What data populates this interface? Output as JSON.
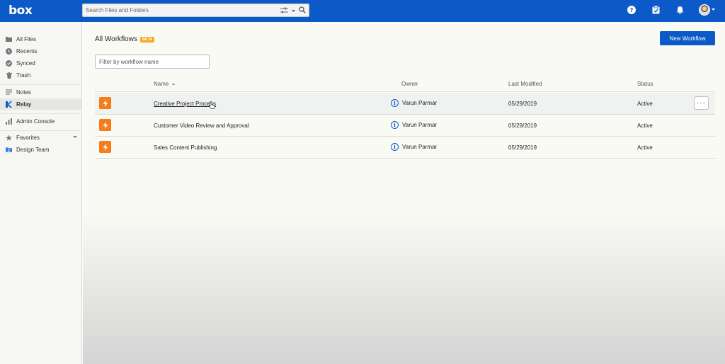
{
  "app": {
    "logo": "box"
  },
  "search": {
    "placeholder": "Search Files and Folders"
  },
  "topbar": {
    "icons": [
      "help-icon",
      "tasks-icon",
      "notifications-icon",
      "avatar"
    ]
  },
  "sidebar": {
    "items": [
      {
        "label": "All Files",
        "icon": "folder-icon"
      },
      {
        "label": "Recents",
        "icon": "clock-icon"
      },
      {
        "label": "Synced",
        "icon": "check-circle-icon"
      },
      {
        "label": "Trash",
        "icon": "trash-icon"
      },
      {
        "label": "Notes",
        "icon": "notes-icon"
      },
      {
        "label": "Relay",
        "icon": "relay-icon",
        "active": true
      },
      {
        "label": "Admin Console",
        "icon": "bar-chart-icon"
      },
      {
        "label": "Favorites",
        "icon": "star-icon"
      },
      {
        "label": "Design Team",
        "icon": "folder-collab-icon"
      }
    ]
  },
  "main": {
    "title": "All Workflows",
    "badge": "BETA",
    "new_button": "New Workflow",
    "filter_placeholder": "Filter by workflow name",
    "columns": {
      "name": "Name",
      "owner": "Owner",
      "modified": "Last Modified",
      "status": "Status"
    },
    "rows": [
      {
        "name": "Creative Project Process",
        "owner": "Varun Parmar",
        "modified": "05/29/2019",
        "status": "Active"
      },
      {
        "name": "Customer Video Review and Approval",
        "owner": "Varun Parmar",
        "modified": "05/29/2019",
        "status": "Active"
      },
      {
        "name": "Sales Content Publishing",
        "owner": "Varun Parmar",
        "modified": "05/29/2019",
        "status": "Active"
      }
    ],
    "more_label": "···"
  },
  "colors": {
    "brand": "#0b5ac7",
    "accent": "#f57c19",
    "badge": "#f8a61c"
  }
}
